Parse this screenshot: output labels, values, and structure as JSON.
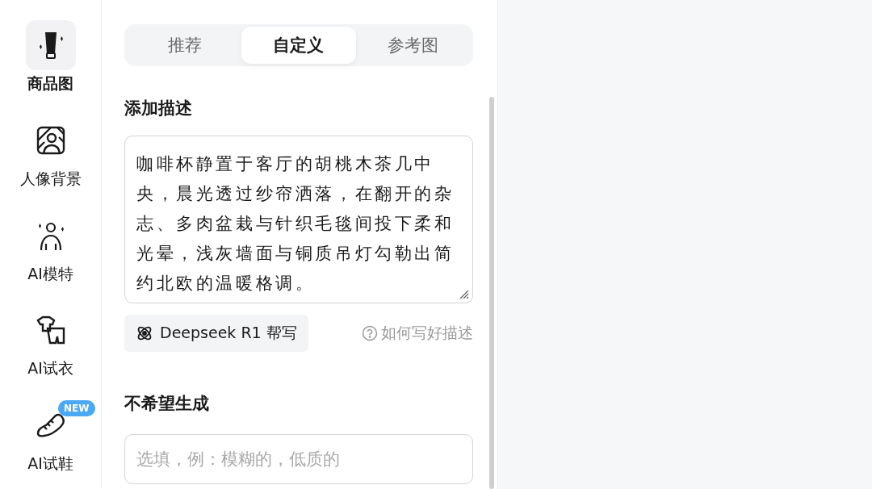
{
  "sidebar": {
    "items": [
      {
        "kind": "bottle",
        "label": "商品图",
        "selected": true
      },
      {
        "kind": "portrait",
        "label": "人像背景",
        "selected": false
      },
      {
        "kind": "figure",
        "label": "AI模特",
        "selected": false
      },
      {
        "kind": "clothes",
        "label": "AI试衣",
        "selected": false
      },
      {
        "kind": "shoe",
        "label": "AI试鞋",
        "selected": false,
        "badge": "NEW"
      }
    ]
  },
  "tabs": [
    {
      "label": "推荐",
      "selected": false
    },
    {
      "label": "自定义",
      "selected": true
    },
    {
      "label": "参考图",
      "selected": false
    }
  ],
  "description": {
    "heading": "添加描述",
    "value": "咖啡杯静置于客厅的胡桃木茶几中央，晨光透过纱帘洒落，在翻开的杂志、多肉盆栽与针织毛毯间投下柔和光晕，浅灰墙面与铜质吊灯勾勒出简约北欧的温暖格调。",
    "assist_button": "Deepseek R1 帮写",
    "help_link": "如何写好描述"
  },
  "negative": {
    "heading": "不希望生成",
    "placeholder": "选填，例：模糊的，低质的"
  }
}
